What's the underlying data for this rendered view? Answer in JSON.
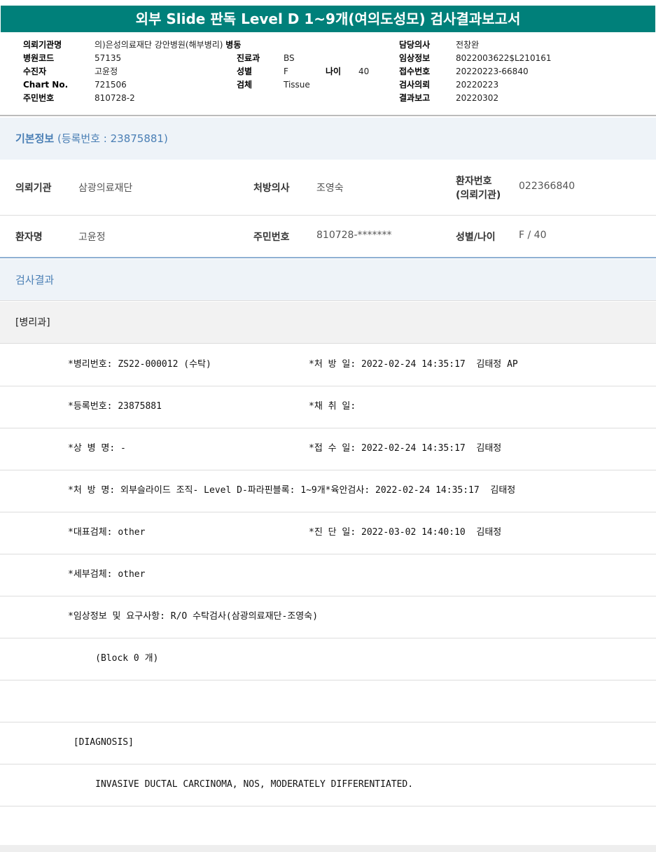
{
  "title": "외부 Slide 판독 Level D 1~9개(여의도성모) 검사결과보고서",
  "header": {
    "inst_label": "의뢰기관명",
    "inst": "의)은성의료재단 강안병원(해부병리)",
    "ward_label": "병동",
    "code_label": "병원코드",
    "code": "57135",
    "dept_label": "진료과",
    "dept": "BS",
    "patient_label": "수진자",
    "patient": "고윤정",
    "sex_label": "성별",
    "sex": "F",
    "age_label": "나이",
    "age": "40",
    "chart_label": "Chart No.",
    "chart": "721506",
    "spec_label": "검체",
    "spec": "Tissue",
    "rrn_label": "주민번호",
    "rrn": "810728-2",
    "doctor_label": "담당의사",
    "doctor": "전창완",
    "clinical_label": "임상정보",
    "clinical": "8022003622$L210161",
    "recv_label": "접수번호",
    "recv": "20220223-66840",
    "req_label": "검사의뢰",
    "req": "20220223",
    "report_label": "결과보고",
    "report": "20220302"
  },
  "basic": {
    "title": "기본정보",
    "reg": "(등록번호 : 23875881)",
    "inst_label": "의뢰기관",
    "inst": "삼광의료재단",
    "doc_label": "처방의사",
    "doc": "조영숙",
    "pid_label1": "환자번호",
    "pid_label2": "(의뢰기관)",
    "pid": "022366840",
    "name_label": "환자명",
    "name": "고윤정",
    "rrn_label": "주민번호",
    "rrn": "810728-*******",
    "sexage_label": "성별/나이",
    "sexage": "F / 40"
  },
  "result": {
    "title": "검사결과",
    "dept": "[병리과]",
    "rows": [
      {
        "l": "*병리번호: ZS22-000012 (수탁)",
        "r": "*처 방 일: 2022-02-24 14:35:17  김태정 AP"
      },
      {
        "l": "*등록번호: 23875881",
        "r": "*채 취 일:"
      },
      {
        "l": "*상 병 명: -",
        "r": "*접 수 일: 2022-02-24 14:35:17  김태정"
      },
      {
        "l": "*처 방 명: 외부슬라이드 조직- Level D-파라핀블록: 1~9개*육안검사: 2022-02-24 14:35:17  김태정",
        "r": ""
      },
      {
        "l": "*대표검체: other",
        "r": "*진 단 일: 2022-03-02 14:40:10  김태정"
      },
      {
        "l": "*세부검체: other",
        "r": ""
      },
      {
        "l": "*임상정보 및 요구사항: R/O 수탁검사(삼광의료재단-조영숙)",
        "r": ""
      },
      {
        "l": "     (Block 0 개)",
        "r": ""
      },
      {
        "l": "",
        "r": ""
      },
      {
        "l": " [DIAGNOSIS]",
        "r": ""
      },
      {
        "l": "     INVASIVE DUCTAL CARCINOMA, NOS, MODERATELY DIFFERENTIATED.",
        "r": ""
      },
      {
        "l": "",
        "r": ""
      }
    ]
  }
}
